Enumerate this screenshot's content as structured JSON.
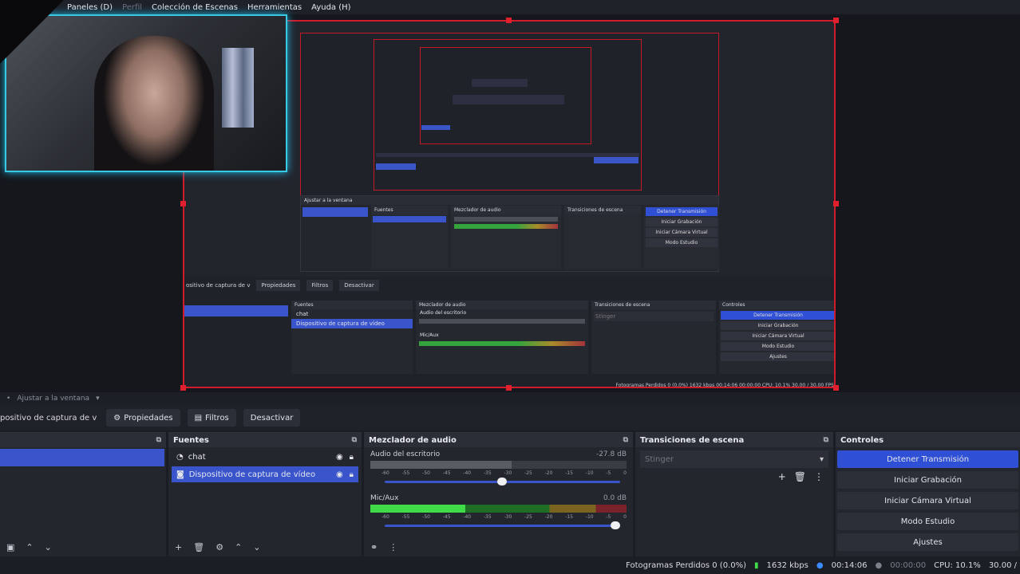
{
  "menubar": {
    "items": [
      "Paneles (D)",
      "Perfil",
      "Colección de Escenas",
      "Herramientas",
      "Ayuda (H)"
    ]
  },
  "preview": {
    "inner_controls": [
      "Detener Transmisión",
      "Iniciar Grabación",
      "Iniciar Cámara Virtual",
      "Modo Estudio",
      "Ajustes"
    ],
    "inner_sources": [
      "chat",
      "Dispositivo de captura de vídeo"
    ],
    "inner_docks": [
      "Fuentes",
      "Mezclador de audio",
      "Transiciones de escena",
      "Controles"
    ],
    "inner_toolbar": [
      "Propiedades",
      "Filtros",
      "Desactivar"
    ],
    "inner_source_label": "ositivo de captura de v",
    "inner_scene_label": "Ajustar a la ventana",
    "inner_audio": [
      "Audio del escritorio",
      "Mic/Aux"
    ],
    "inner_transition": "Stinger",
    "inner_status": "Fotogramas Perdidos 0 (0.0%)   1632 kbps   00:14:06   00:00:00   CPU: 10.1%   30.00 / 30.00 FPS"
  },
  "scene_toolbar": {
    "label": "Ajustar a la ventana"
  },
  "source_toolbar": {
    "selected": "positivo de captura de v",
    "properties": "Propiedades",
    "filters": "Filtros",
    "deactivate": "Desactivar"
  },
  "sources": {
    "title": "Fuentes",
    "items": [
      {
        "label": "chat",
        "selected": false
      },
      {
        "label": "Dispositivo de captura de vídeo",
        "selected": true
      }
    ]
  },
  "mixer": {
    "title": "Mezclador de audio",
    "channels": [
      {
        "name": "Audio del escritorio",
        "db": "-27.8 dB",
        "level": 0.55,
        "volume": 0.52
      },
      {
        "name": "Mic/Aux",
        "db": "0.0 dB",
        "level": 0.37,
        "volume": 1.0
      }
    ],
    "ticks": [
      "-60",
      "-55",
      "-50",
      "-45",
      "-40",
      "-35",
      "-30",
      "-25",
      "-20",
      "-15",
      "-10",
      "-5",
      "0"
    ]
  },
  "transitions": {
    "title": "Transiciones de escena",
    "selected": "Stinger"
  },
  "controls": {
    "title": "Controles",
    "buttons": [
      "Detener Transmisión",
      "Iniciar Grabación",
      "Iniciar Cámara Virtual",
      "Modo Estudio",
      "Ajustes"
    ]
  },
  "status": {
    "dropped": "Fotogramas Perdidos 0 (0.0%)",
    "bitrate": "1632 kbps",
    "stream_time": "00:14:06",
    "rec_time": "00:00:00",
    "cpu": "CPU: 10.1%",
    "fps": "30.00 /"
  },
  "colors": {
    "accent": "#3a55cc",
    "live_border": "#d01b2b",
    "webcam_glow": "#37c9e6"
  }
}
